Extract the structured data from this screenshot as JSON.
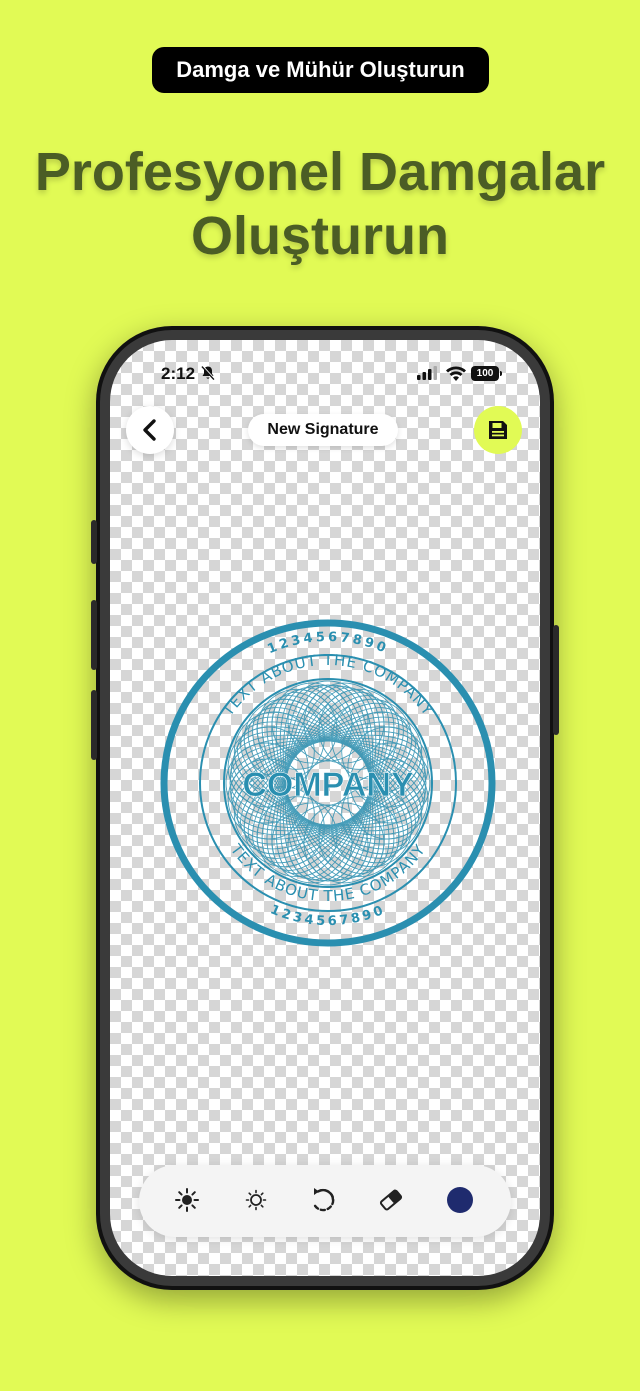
{
  "header": {
    "badge_text": "Damga ve Mühür Oluşturun",
    "headline_line1": "Profesyonel Damgalar",
    "headline_line2": "Oluşturun"
  },
  "status_bar": {
    "time": "2:12",
    "battery": "100",
    "icons": [
      "bell-slash-icon",
      "signal-icon",
      "wifi-icon",
      "battery-icon"
    ]
  },
  "app_bar": {
    "back_icon": "chevron-left-icon",
    "title": "New Signature",
    "save_icon": "floppy-disk-icon"
  },
  "stamp": {
    "center_text": "COMPANY",
    "ring_text": "TEXT ABOUT THE COMPANY",
    "ring_numbers": "1234567890",
    "color": "#2a8fb0"
  },
  "toolbar": {
    "tools": [
      {
        "name": "brightness-high-icon"
      },
      {
        "name": "brightness-low-icon"
      },
      {
        "name": "rotate-icon"
      },
      {
        "name": "eraser-icon"
      },
      {
        "name": "color-picker"
      }
    ],
    "selected_color": "#1f2b6e"
  },
  "colors": {
    "background": "#e1fa55",
    "headline": "#4b5d25",
    "accent": "#e1fa55"
  }
}
